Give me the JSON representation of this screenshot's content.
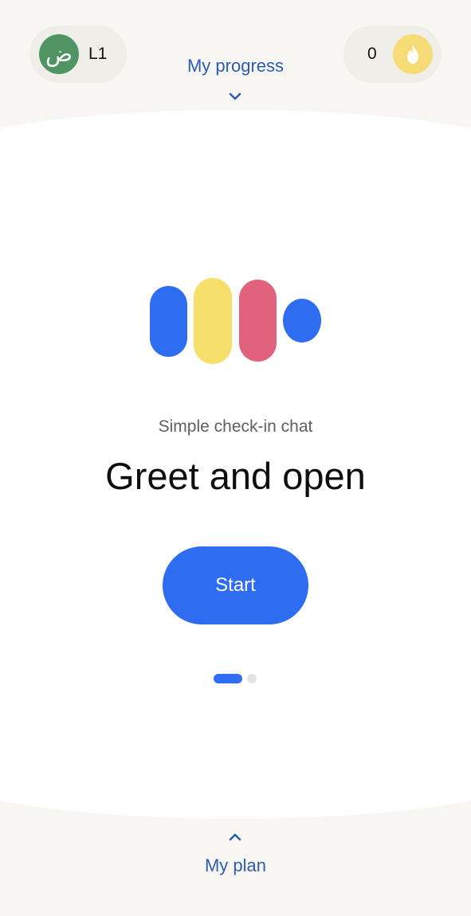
{
  "header": {
    "level_avatar_glyph": "ض",
    "level_label": "L1",
    "progress_label": "My progress",
    "streak_count": "0",
    "icons": {
      "level": "arabic-letter-avatar-icon",
      "progress_toggle": "chevron-down-icon",
      "streak": "flame-icon"
    }
  },
  "main": {
    "subtitle": "Simple check-in chat",
    "title": "Greet and open",
    "start_label": "Start",
    "pager": {
      "total": 2,
      "active_index": 0
    }
  },
  "footer": {
    "plan_label": "My plan",
    "icons": {
      "plan_toggle": "chevron-up-icon"
    }
  },
  "colors": {
    "accent_blue": "#2e6cf1",
    "link_blue": "#2d5cb0",
    "yellow": "#f6df6a",
    "pink": "#e0627c",
    "avatar_green": "#4f9462",
    "flame_bg": "#f6dc77",
    "band": "#f7f6f3"
  }
}
